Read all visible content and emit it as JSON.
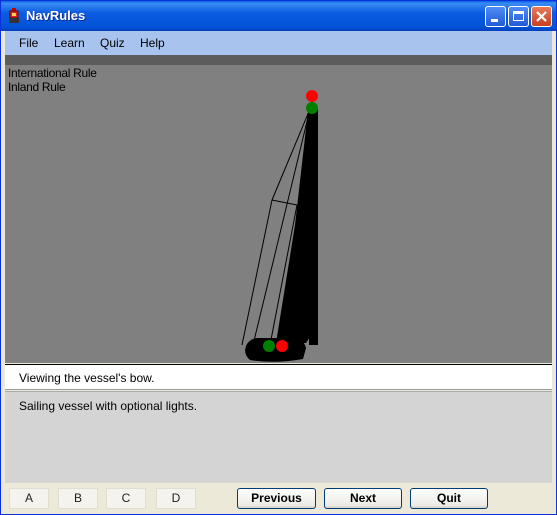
{
  "window": {
    "title": "NavRules"
  },
  "menu": {
    "items": [
      "File",
      "Learn",
      "Quiz",
      "Help"
    ]
  },
  "rules": {
    "international": "International Rule",
    "inland": "Inland Rule"
  },
  "status": {
    "text": "Viewing the vessel's bow."
  },
  "description": {
    "text": "Sailing vessel with optional lights."
  },
  "answers": {
    "labels": [
      "A",
      "B",
      "C",
      "D"
    ]
  },
  "nav": {
    "previous": "Previous",
    "next": "Next",
    "quit": "Quit"
  },
  "lights": {
    "masthead_top": "red",
    "masthead_bottom": "green",
    "sidelight_port": "red",
    "sidelight_starboard": "green"
  },
  "colors": {
    "red_light": "#ff0000",
    "green_light": "#008000",
    "scene_background": "#808080"
  }
}
